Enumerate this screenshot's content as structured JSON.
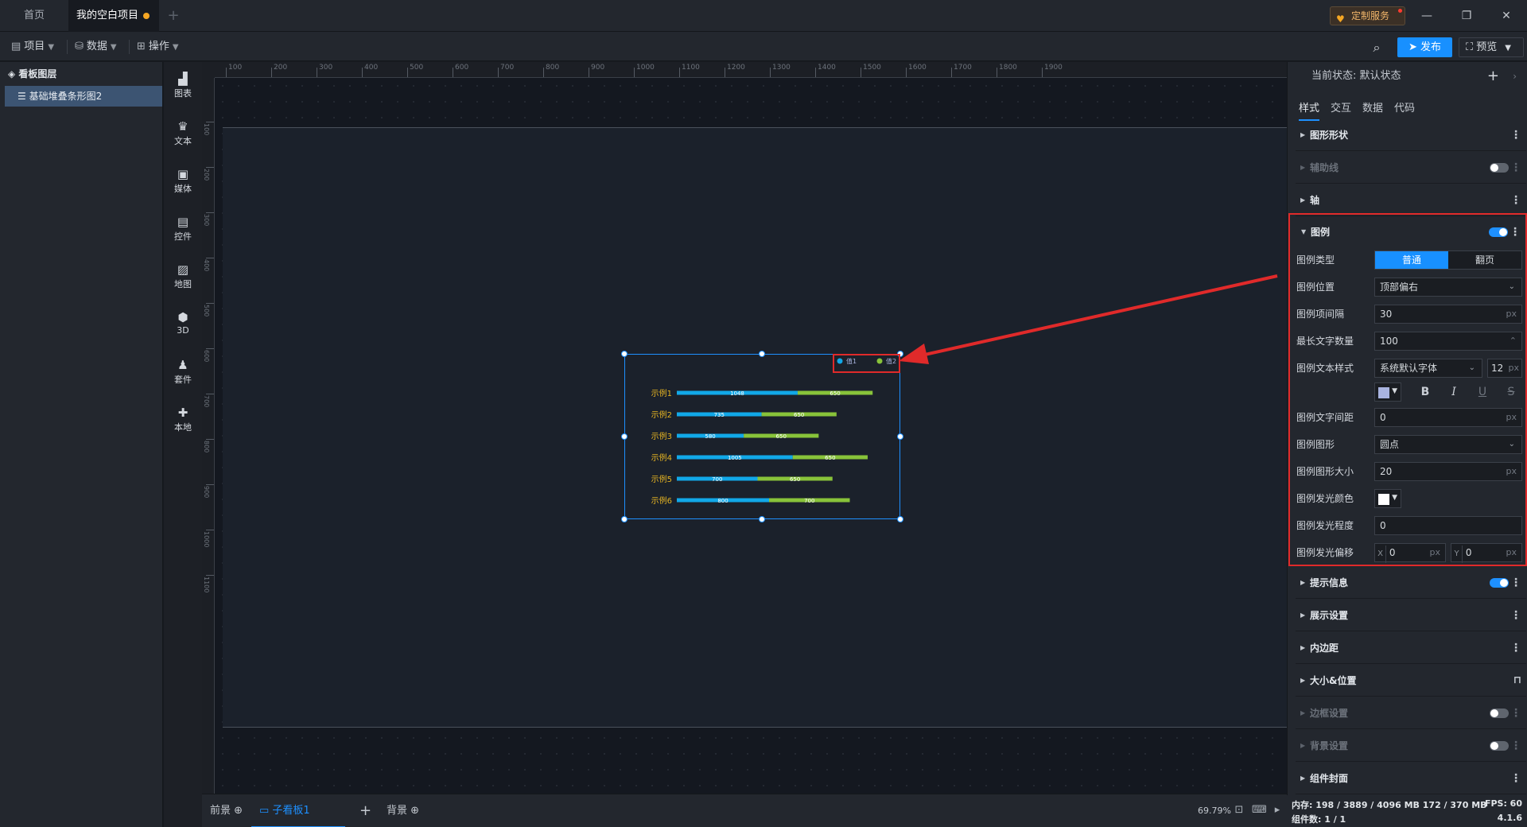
{
  "tabs": {
    "home": "首页",
    "project": "我的空白项目"
  },
  "header": {
    "custom_service": "定制服务"
  },
  "toolbar": {
    "project": "项目",
    "data": "数据",
    "operate": "操作",
    "publish": "发布",
    "preview": "预览"
  },
  "layers": {
    "title": "看板图层",
    "item": "基础堆叠条形图2"
  },
  "components": [
    {
      "label": "图表",
      "icon": "bar-chart-icon"
    },
    {
      "label": "文本",
      "icon": "text-icon"
    },
    {
      "label": "媒体",
      "icon": "media-icon"
    },
    {
      "label": "控件",
      "icon": "control-icon"
    },
    {
      "label": "地图",
      "icon": "map-icon"
    },
    {
      "label": "3D",
      "icon": "cube-icon"
    },
    {
      "label": "套件",
      "icon": "kit-icon"
    },
    {
      "label": "本地",
      "icon": "puzzle-icon"
    }
  ],
  "ruler": {
    "top_ticks": [
      "100",
      "200",
      "300",
      "400",
      "500",
      "600",
      "700",
      "800",
      "900",
      "1000",
      "1100",
      "1200",
      "1300",
      "1400",
      "1500",
      "1600",
      "1700",
      "1800",
      "1900"
    ],
    "left_ticks": [
      "100",
      "200",
      "300",
      "400",
      "500",
      "600",
      "700",
      "800",
      "900",
      "1000",
      "1100"
    ]
  },
  "chart_data": {
    "type": "bar",
    "orientation": "horizontal",
    "stacked": true,
    "categories": [
      "示例1",
      "示例2",
      "示例3",
      "示例4",
      "示例5",
      "示例6"
    ],
    "series": [
      {
        "name": "值1",
        "color": "#11a8e8",
        "values": [
          1048,
          735,
          580,
          1005,
          700,
          800
        ]
      },
      {
        "name": "值2",
        "color": "#88c33a",
        "values": [
          650,
          650,
          650,
          650,
          650,
          700
        ]
      }
    ],
    "legend_position": "top-right",
    "label_color": "#e6b422"
  },
  "bottom": {
    "front": "前景",
    "sub_board": "子看板1",
    "background": "背景",
    "zoom": "69.79%"
  },
  "panel": {
    "state_label": "当前状态:",
    "state_value": "默认状态",
    "tabs": [
      "样式",
      "交互",
      "数据",
      "代码"
    ],
    "sections_top": [
      "图形形状",
      "辅助线",
      "轴"
    ],
    "legend_title": "图例",
    "legend": {
      "type_label": "图例类型",
      "type_normal": "普通",
      "type_page": "翻页",
      "position_label": "图例位置",
      "position_value": "顶部偏右",
      "gap_label": "图例项间隔",
      "gap_value": "30",
      "maxlen_label": "最长文字数量",
      "maxlen_value": "100",
      "textstyle_label": "图例文本样式",
      "font_value": "系统默认字体",
      "font_size": "12",
      "text_color": "#a9b4e0",
      "letterspace_label": "图例文字间距",
      "letterspace_value": "0",
      "shape_label": "图例图形",
      "shape_value": "圆点",
      "shapesize_label": "图例图形大小",
      "shapesize_value": "20",
      "glowcolor_label": "图例发光颜色",
      "glow_color": "#ffffff",
      "glowlevel_label": "图例发光程度",
      "glowlevel_value": "0",
      "glowoffset_label": "图例发光偏移",
      "offset_x": "0",
      "offset_y": "0",
      "unit": "px",
      "x_label": "X",
      "y_label": "Y"
    },
    "sections_bottom": [
      "提示信息",
      "展示设置",
      "内边距",
      "大小&位置",
      "边框设置",
      "背景设置",
      "组件封面"
    ]
  },
  "footer": {
    "memory": "内存: 198 / 3889 / 4096 MB  172 / 370 MB",
    "fps": "FPS: 60",
    "count": "组件数: 1 / 1",
    "version": "4.1.6"
  }
}
